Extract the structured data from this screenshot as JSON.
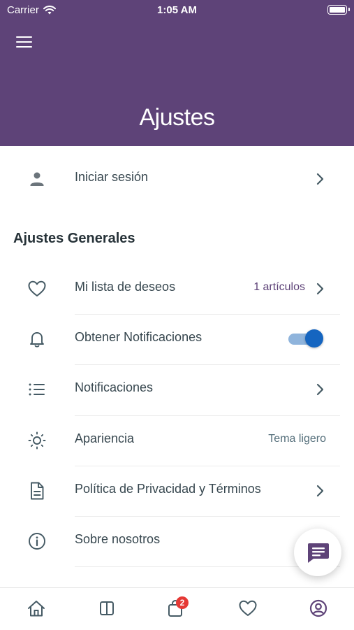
{
  "status_bar": {
    "carrier": "Carrier",
    "time": "1:05 AM"
  },
  "header": {
    "title": "Ajustes",
    "menu_icon": "hamburger-menu-icon"
  },
  "login": {
    "label": "Iniciar sesión",
    "icon": "person-icon"
  },
  "general": {
    "title": "Ajustes Generales",
    "items": [
      {
        "label": "Mi lista de deseos",
        "value": "1 artículos",
        "icon": "heart-outline-icon"
      },
      {
        "label": "Obtener Notificaciones",
        "toggle_on": true,
        "icon": "bell-icon"
      },
      {
        "label": "Notificaciones",
        "icon": "list-icon"
      },
      {
        "label": "Apariencia",
        "value": "Tema ligero",
        "icon": "sun-icon"
      },
      {
        "label": "Política de Privacidad y Términos",
        "icon": "document-icon"
      },
      {
        "label": "Sobre nosotros",
        "icon": "info-icon"
      }
    ]
  },
  "fab": {
    "icon": "chat-icon"
  },
  "tabbar": {
    "tabs": [
      "home-icon",
      "columns-icon",
      "shopping-bag-icon",
      "heart-icon",
      "account-circle-icon"
    ],
    "cart_badge": "2"
  },
  "colors": {
    "header": "#5e4378",
    "accent": "#5e4378",
    "toggle": "#1565c0",
    "text": "#37474f",
    "badge": "#e53935"
  }
}
